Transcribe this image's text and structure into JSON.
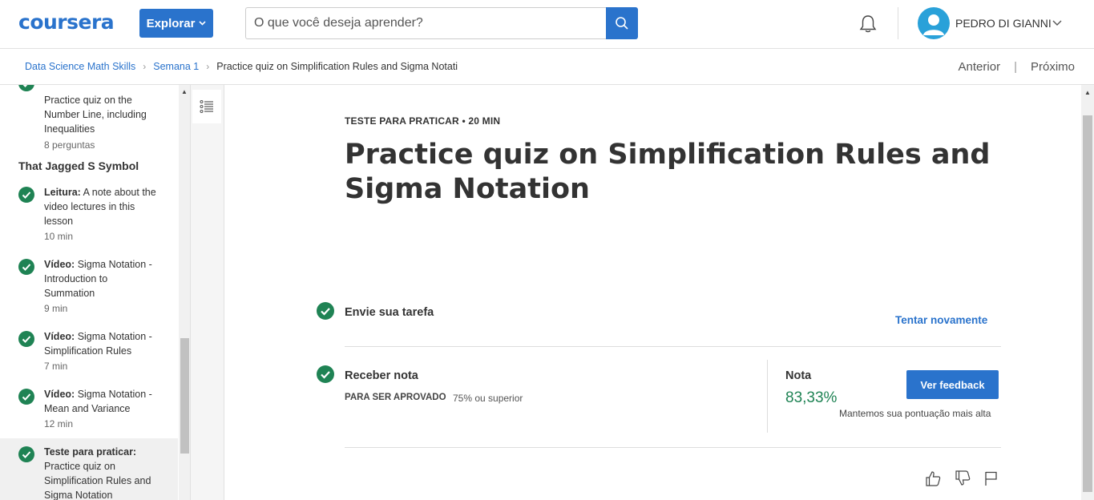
{
  "header": {
    "logo_text": "coursera",
    "explore_label": "Explorar",
    "search_placeholder": "O que você deseja aprender?",
    "user_name": "PEDRO DI GIANNI",
    "icons": [
      "search-icon",
      "bell-icon",
      "user-avatar-icon",
      "chevron-down-icon"
    ]
  },
  "breadcrumb": {
    "items": [
      "Data Science Math Skills",
      "Semana 1"
    ],
    "current": "Practice quiz on Simplification Rules and Sigma Notati",
    "prev_label": "Anterior",
    "next_label": "Próximo"
  },
  "sidebar": {
    "top_item": {
      "text": "Practice quiz on the Number Line, including Inequalities",
      "meta": "8 perguntas"
    },
    "section_title": "That Jagged S Symbol",
    "items": [
      {
        "kind": "Leitura:",
        "text": "A note about the video lectures in this lesson",
        "meta": "10 min"
      },
      {
        "kind": "Vídeo:",
        "text": "Sigma Notation - Introduction to Summation",
        "meta": "9 min"
      },
      {
        "kind": "Vídeo:",
        "text": "Sigma Notation - Simplification Rules",
        "meta": "7 min"
      },
      {
        "kind": "Vídeo:",
        "text": "Sigma Notation - Mean and Variance",
        "meta": "12 min"
      },
      {
        "kind": "Teste para praticar:",
        "text": "Practice quiz on Simplification Rules and Sigma Notation",
        "meta": ""
      }
    ]
  },
  "main": {
    "item_type": "TESTE PARA PRATICAR • 20 MIN",
    "title": "Practice quiz on Simplification Rules and Sigma Notation",
    "step1_label": "Envie sua tarefa",
    "retry_label": "Tentar novamente",
    "step2_label": "Receber nota",
    "pass_label": "PARA SER APROVADO",
    "pass_value": "75% ou superior",
    "grade_label": "Nota",
    "grade_value": "83,33%",
    "feedback_button": "Ver feedback",
    "keep_note": "Mantemos sua pontuação mais alta"
  },
  "colors": {
    "brand_blue": "#2a73cc",
    "success_green": "#1f8354"
  }
}
